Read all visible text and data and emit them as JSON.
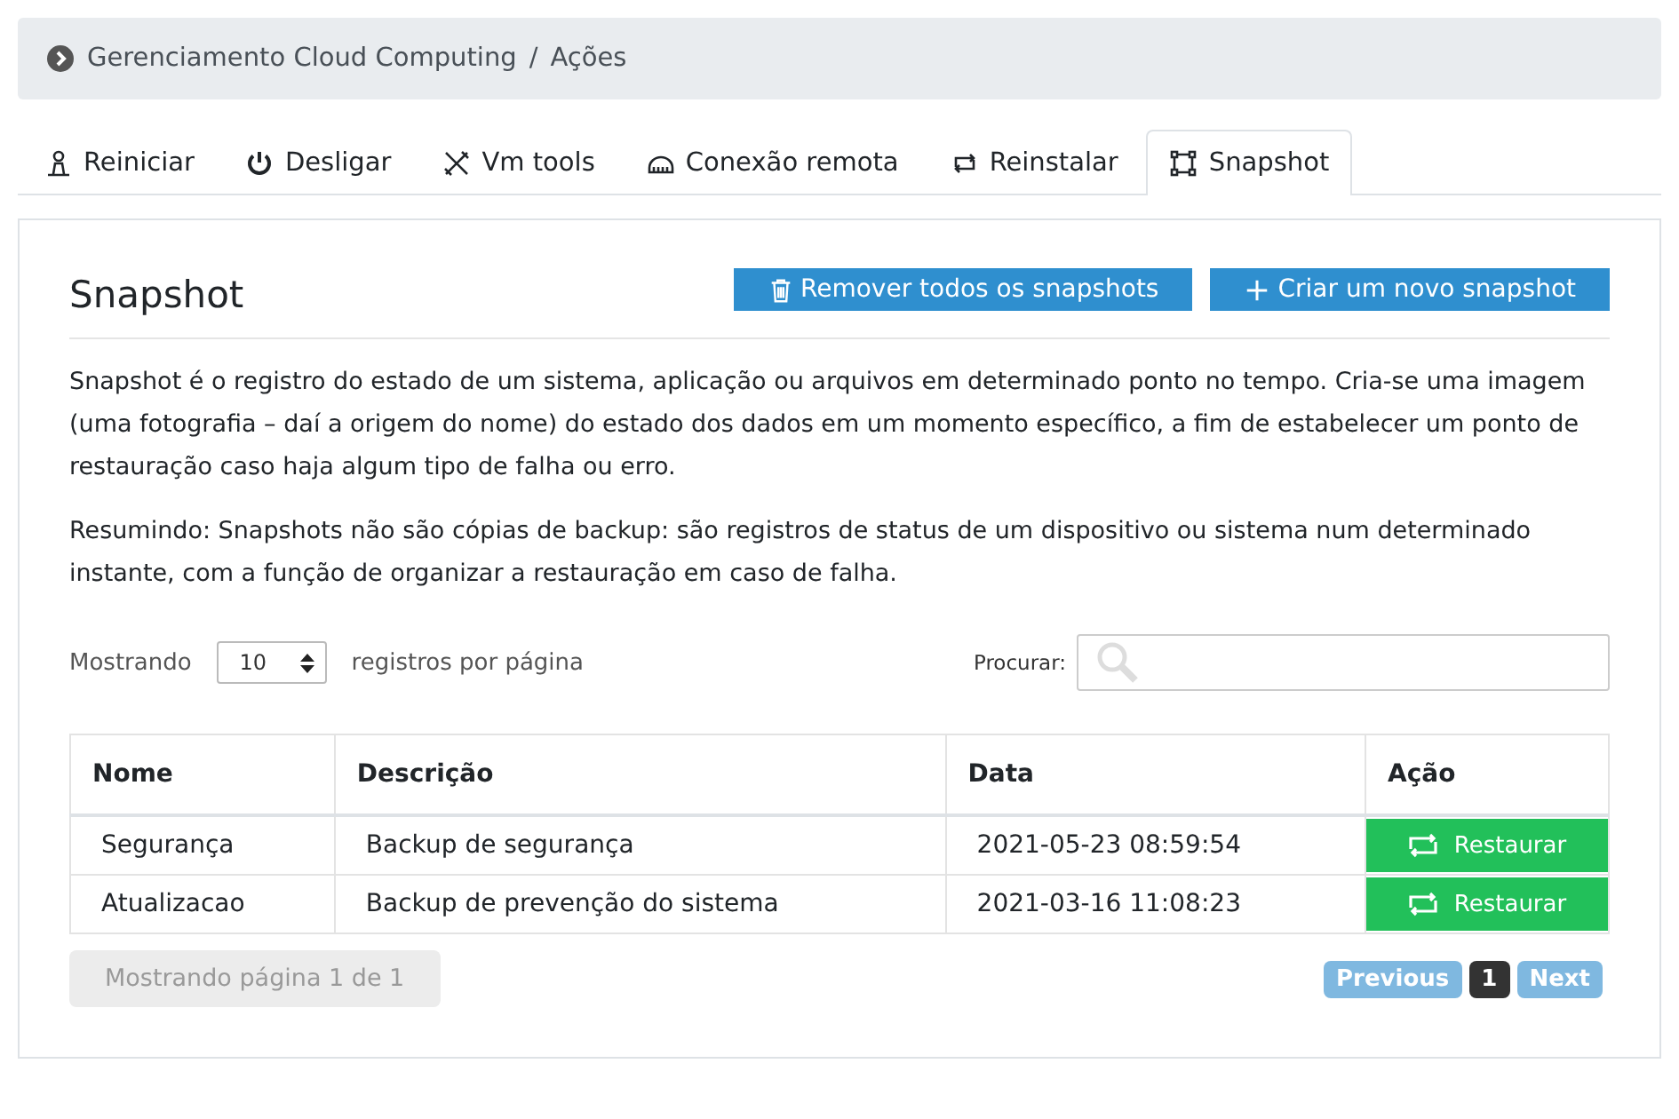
{
  "breadcrumb": {
    "items": [
      "Gerenciamento Cloud Computing",
      "Ações"
    ],
    "separator": "/"
  },
  "tabs": [
    {
      "label": "Reiniciar",
      "selected": false
    },
    {
      "label": "Desligar",
      "selected": false
    },
    {
      "label": "Vm tools",
      "selected": false
    },
    {
      "label": "Conexão remota",
      "selected": false
    },
    {
      "label": "Reinstalar",
      "selected": false
    },
    {
      "label": "Snapshot",
      "selected": true
    }
  ],
  "panel": {
    "title": "Snapshot",
    "buttons": [
      {
        "kind": "delete",
        "label": "Remover todos os snapshots"
      },
      {
        "kind": "add",
        "label": "Criar um novo snapshot"
      }
    ],
    "paragraphs": [
      "Snapshot é o registro do estado de um sistema, aplicação ou arquivos em determinado ponto no tempo. Cria-se uma imagem (uma fotografia – daí a origem do nome) do estado dos dados em um momento específico, a fim de estabelecer um ponto de restauração caso haja algum tipo de falha ou erro.",
      "Resumindo: Snapshots não são cópias de backup: são registros de status de um dispositivo ou sistema num determinado instante, com a função de organizar a restauração em caso de falha."
    ]
  },
  "length": {
    "prefix": "Mostrando",
    "value": "10",
    "suffix": "registros por página"
  },
  "search": {
    "label": "Procurar:"
  },
  "table": {
    "columns": [
      "Nome",
      "Descrição",
      "Data",
      "Ação"
    ],
    "rows": [
      {
        "name": "Segurança",
        "description": "Backup de segurança",
        "date": "2021-05-23 08:59:54",
        "action": "Restaurar"
      },
      {
        "name": "Atualizacao",
        "description": "Backup de prevenção do sistema",
        "date": "2021-03-16 11:08:23",
        "action": "Restaurar"
      }
    ]
  },
  "info": "Mostrando página 1 de 1",
  "pagination": {
    "previous": {
      "label": "Previous",
      "disabled": true
    },
    "pages": [
      {
        "label": "1",
        "selected": true
      }
    ],
    "next": {
      "label": "Next",
      "disabled": true
    }
  }
}
